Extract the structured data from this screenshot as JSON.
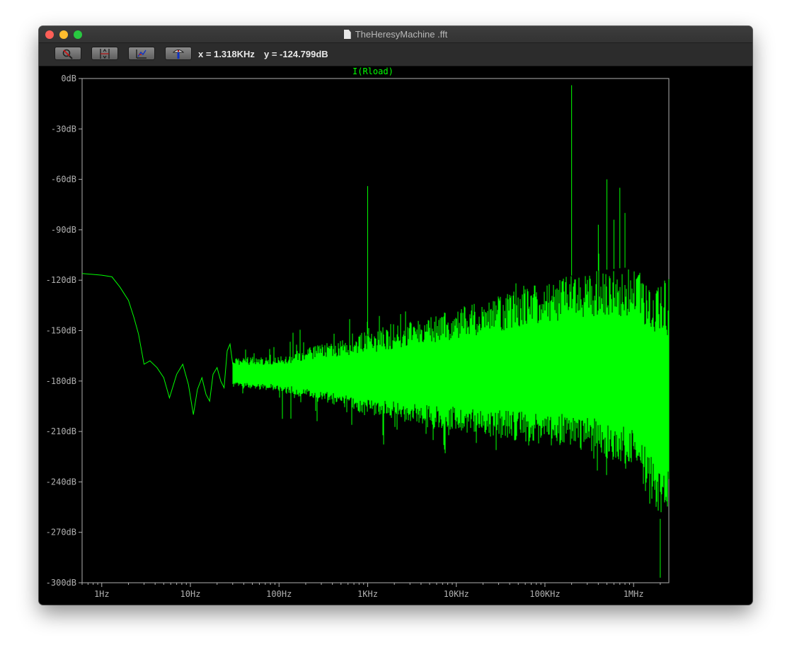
{
  "window": {
    "title": "TheHeresyMachine .fft"
  },
  "toolbar": {
    "buttons": [
      {
        "name": "zoom-tool",
        "icon": "magnifier-crossed-icon"
      },
      {
        "name": "vertical-scale-tool",
        "icon": "axis-scale-icon"
      },
      {
        "name": "autorange-tool",
        "icon": "autorange-icon"
      },
      {
        "name": "probe-tool",
        "icon": "probe-icon"
      }
    ],
    "cursor_x": "x = 1.318KHz",
    "cursor_y": "y = -124.799dB"
  },
  "colors": {
    "trace": "#00ff00",
    "axis": "#b0b0b0",
    "background": "#000000"
  },
  "chart_data": {
    "type": "line",
    "series": [
      {
        "name": "I(Rload)"
      }
    ],
    "x_scale": "log",
    "xlim": [
      0.6,
      2500000
    ],
    "ylim": [
      -300,
      0
    ],
    "x_ticks": [
      {
        "value": 1,
        "label": "1Hz"
      },
      {
        "value": 10,
        "label": "10Hz"
      },
      {
        "value": 100,
        "label": "100Hz"
      },
      {
        "value": 1000,
        "label": "1KHz"
      },
      {
        "value": 10000,
        "label": "10KHz"
      },
      {
        "value": 100000,
        "label": "100KHz"
      },
      {
        "value": 1000000,
        "label": "1MHz"
      }
    ],
    "y_ticks": [
      {
        "value": 0,
        "label": "0dB"
      },
      {
        "value": -30,
        "label": "-30dB"
      },
      {
        "value": -60,
        "label": "-60dB"
      },
      {
        "value": -90,
        "label": "-90dB"
      },
      {
        "value": -120,
        "label": "-120dB"
      },
      {
        "value": -150,
        "label": "-150dB"
      },
      {
        "value": -180,
        "label": "-180dB"
      },
      {
        "value": -210,
        "label": "-210dB"
      },
      {
        "value": -240,
        "label": "-240dB"
      },
      {
        "value": -270,
        "label": "-270dB"
      },
      {
        "value": -300,
        "label": "-300dB"
      }
    ],
    "low_freq_curve": [
      [
        0.6,
        -116
      ],
      [
        1.0,
        -117
      ],
      [
        1.3,
        -118
      ],
      [
        1.6,
        -124
      ],
      [
        2.0,
        -132
      ],
      [
        2.3,
        -142
      ],
      [
        2.6,
        -152
      ],
      [
        3.0,
        -170
      ],
      [
        3.5,
        -168
      ],
      [
        4.2,
        -172
      ],
      [
        5.0,
        -178
      ],
      [
        5.8,
        -190
      ],
      [
        7.0,
        -176
      ],
      [
        8.2,
        -170
      ],
      [
        9.5,
        -182
      ],
      [
        10.8,
        -200
      ],
      [
        12.0,
        -185
      ],
      [
        13.5,
        -178
      ],
      [
        15.0,
        -188
      ],
      [
        16.5,
        -192
      ],
      [
        18.0,
        -176
      ],
      [
        20.0,
        -172
      ],
      [
        22.0,
        -180
      ],
      [
        24.0,
        -184
      ],
      [
        26.0,
        -162
      ],
      [
        28.0,
        -158
      ],
      [
        30.0,
        -170
      ],
      [
        33.0,
        -176
      ],
      [
        36.0,
        -182
      ]
    ],
    "noise_envelope": [
      {
        "f": 30,
        "upper": -166,
        "lower": -184
      },
      {
        "f": 100,
        "upper": -165,
        "lower": -186
      },
      {
        "f": 300,
        "upper": -158,
        "lower": -193
      },
      {
        "f": 1000,
        "upper": -152,
        "lower": -200
      },
      {
        "f": 10000,
        "upper": -137,
        "lower": -210
      },
      {
        "f": 100000,
        "upper": -121,
        "lower": -218
      },
      {
        "f": 300000,
        "upper": -115,
        "lower": -222
      },
      {
        "f": 1000000,
        "upper": -112,
        "lower": -232
      },
      {
        "f": 2000000,
        "upper": -118,
        "lower": -262
      }
    ],
    "peaks": [
      {
        "f": 1000,
        "db": -64
      },
      {
        "f": 200000,
        "db": -4
      },
      {
        "f": 400000,
        "db": -87
      },
      {
        "f": 500000,
        "db": -60
      },
      {
        "f": 600000,
        "db": -84
      },
      {
        "f": 700000,
        "db": -65
      },
      {
        "f": 800000,
        "db": -80
      }
    ],
    "dip": {
      "f": 2000000,
      "db": -297
    }
  }
}
